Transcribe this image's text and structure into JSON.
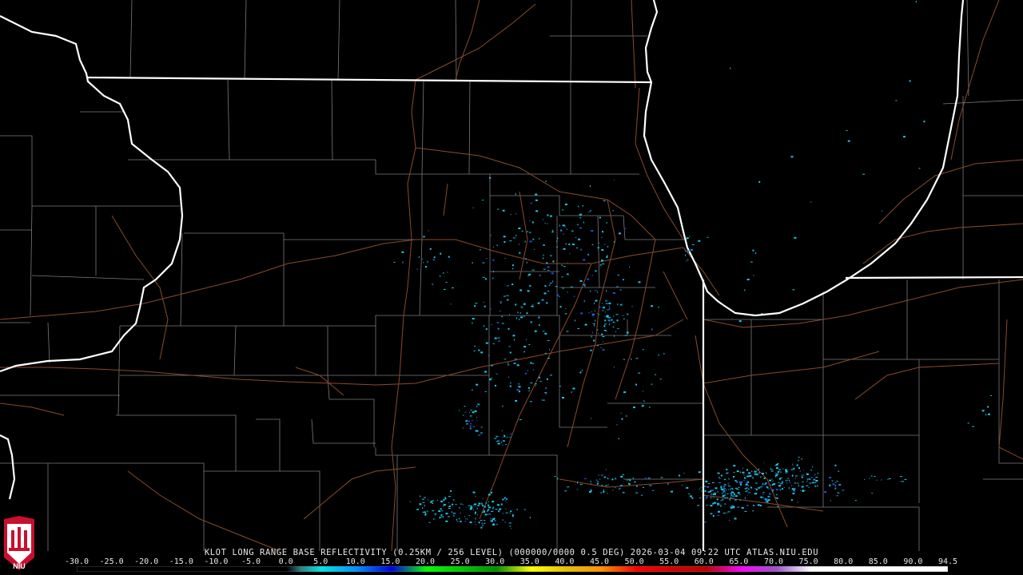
{
  "product": {
    "caption": "KLOT LONG RANGE BASE REFLECTIVITY (0.25KM / 256 LEVEL) (000000/0000 0.5 DEG) 2026-03-04 09:22 UTC  ATLAS.NIU.EDU",
    "logo_text": "NIU"
  },
  "colorbar": {
    "ticks": [
      "-30.0",
      "-25.0",
      "-20.0",
      "-15.0",
      "-10.0",
      "-5.0",
      "0.0",
      "5.0",
      "10.0",
      "15.0",
      "20.0",
      "25.0",
      "30.0",
      "35.0",
      "40.0",
      "45.0",
      "50.0",
      "55.0",
      "60.0",
      "65.0",
      "70.0",
      "75.0",
      "80.0",
      "85.0",
      "90.0",
      "94.5"
    ],
    "stops": [
      {
        "value": -30,
        "color": "#000000"
      },
      {
        "value": 0,
        "color": "#000000"
      },
      {
        "value": 2,
        "color": "#2e7f7f"
      },
      {
        "value": 5,
        "color": "#00e5e5"
      },
      {
        "value": 10,
        "color": "#0090ff"
      },
      {
        "value": 15,
        "color": "#0000e6"
      },
      {
        "value": 20,
        "color": "#00ff00"
      },
      {
        "value": 25,
        "color": "#00c800"
      },
      {
        "value": 30,
        "color": "#009000"
      },
      {
        "value": 35,
        "color": "#ffff00"
      },
      {
        "value": 40,
        "color": "#e7c000"
      },
      {
        "value": 45,
        "color": "#ff9000"
      },
      {
        "value": 50,
        "color": "#ff0000"
      },
      {
        "value": 55,
        "color": "#d60000"
      },
      {
        "value": 60,
        "color": "#c00000"
      },
      {
        "value": 65,
        "color": "#ff00ff"
      },
      {
        "value": 70,
        "color": "#9955c9"
      },
      {
        "value": 75,
        "color": "#ffffff"
      },
      {
        "value": 94.5,
        "color": "#ffffff"
      }
    ]
  },
  "colors": {
    "background": "#000000",
    "state_border": "#ffffff",
    "county_line": "#7a7a7a",
    "highway": "#8b4a2b",
    "echo_light": "#1ec8e8",
    "echo_mid": "#1a8fd8",
    "echo_strong": "#2050e0"
  }
}
